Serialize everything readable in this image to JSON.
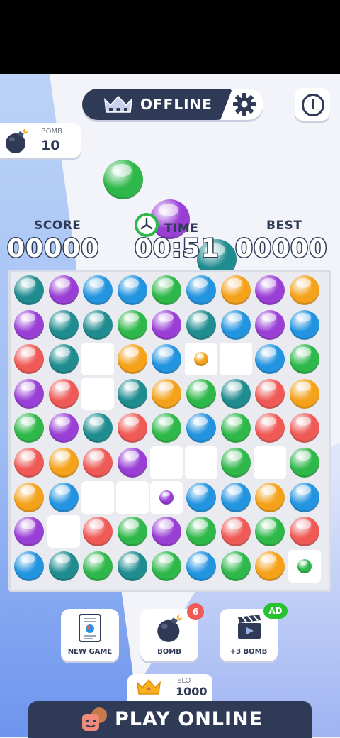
{
  "header": {
    "mode_label": "OFFLINE"
  },
  "bomb_card": {
    "label": "BOMB",
    "value": "10"
  },
  "next_balls": [
    "green",
    "purple",
    "teal"
  ],
  "stats": {
    "score_label": "SCORE",
    "score_value": "00000",
    "time_label": "TIME",
    "time_value": "00:51",
    "best_label": "BEST",
    "best_value": "00000"
  },
  "board": {
    "rows": [
      [
        "teal",
        "purple",
        "blue",
        "blue",
        "green",
        "blue",
        "orange",
        "purple",
        "orange"
      ],
      [
        "purple",
        "teal",
        "teal",
        "green",
        "purple",
        "teal",
        "blue",
        "purple",
        "blue"
      ],
      [
        "red",
        "teal",
        "empty",
        "orange",
        "blue",
        "orange-small",
        "empty",
        "blue",
        "green"
      ],
      [
        "purple",
        "red",
        "empty",
        "teal",
        "orange",
        "green",
        "teal",
        "red",
        "orange"
      ],
      [
        "green",
        "purple",
        "teal",
        "red",
        "green",
        "blue",
        "green",
        "red",
        "red"
      ],
      [
        "red",
        "orange",
        "red",
        "purple",
        "empty",
        "empty",
        "green",
        "empty",
        "green"
      ],
      [
        "orange",
        "blue",
        "empty",
        "empty",
        "purple-small",
        "blue",
        "blue",
        "orange",
        "blue"
      ],
      [
        "purple",
        "empty",
        "red",
        "green",
        "purple",
        "green",
        "red",
        "green",
        "red"
      ],
      [
        "blue",
        "teal",
        "green",
        "teal",
        "green",
        "blue",
        "green",
        "orange",
        "green-small"
      ]
    ]
  },
  "actions": {
    "new_game_label": "NEW GAME",
    "bomb_label": "BOMB",
    "bomb_badge": "6",
    "plus_bomb_label": "+3 BOMB",
    "ad_badge": "AD"
  },
  "elo": {
    "label": "ELO",
    "value": "1000"
  },
  "play_online_label": "PLAY ONLINE",
  "colors": {
    "green": "#2fb84a",
    "purple": "#9a3fd6",
    "teal": "#1f8c8f",
    "blue": "#2394e0",
    "orange": "#f5a21b",
    "red": "#ef5a56",
    "dark": "#2f3a56",
    "badge_red": "#ef5a56",
    "badge_green": "#28c12f"
  }
}
